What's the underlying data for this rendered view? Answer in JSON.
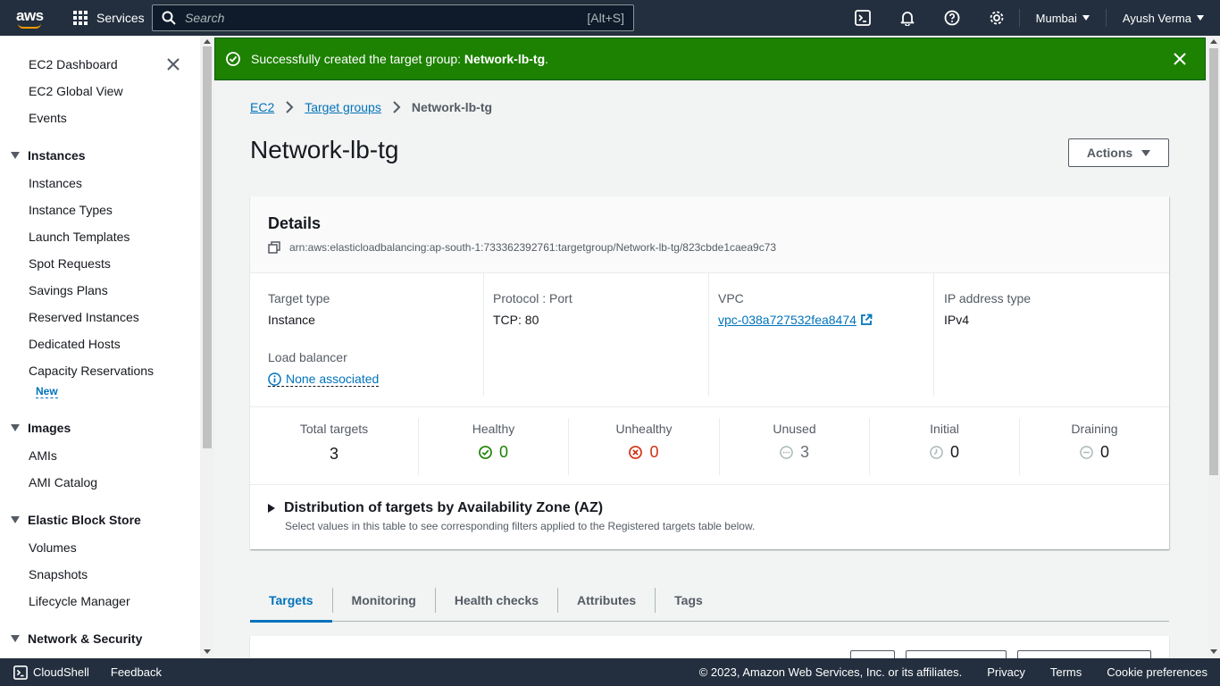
{
  "topnav": {
    "logo": "aws",
    "services_label": "Services",
    "search_placeholder": "Search",
    "search_shortcut": "[Alt+S]",
    "region": "Mumbai",
    "user": "Ayush Verma"
  },
  "sidebar": {
    "top_items": [
      "EC2 Dashboard",
      "EC2 Global View",
      "Events"
    ],
    "sections": [
      {
        "title": "Instances",
        "items": [
          "Instances",
          "Instance Types",
          "Launch Templates",
          "Spot Requests",
          "Savings Plans",
          "Reserved Instances",
          "Dedicated Hosts",
          "Capacity Reservations"
        ],
        "badge": "New"
      },
      {
        "title": "Images",
        "items": [
          "AMIs",
          "AMI Catalog"
        ]
      },
      {
        "title": "Elastic Block Store",
        "items": [
          "Volumes",
          "Snapshots",
          "Lifecycle Manager"
        ]
      },
      {
        "title": "Network & Security",
        "items": []
      }
    ]
  },
  "flash": {
    "prefix": "Successfully created the target group: ",
    "name": "Network-lb-tg",
    "suffix": "."
  },
  "breadcrumb": {
    "items": [
      "EC2",
      "Target groups"
    ],
    "current": "Network-lb-tg"
  },
  "page": {
    "title": "Network-lb-tg",
    "actions_label": "Actions"
  },
  "details": {
    "heading": "Details",
    "arn": "arn:aws:elasticloadbalancing:ap-south-1:733362392761:targetgroup/Network-lb-tg/823cbde1caea9c73",
    "target_type_label": "Target type",
    "target_type": "Instance",
    "protocol_label": "Protocol : Port",
    "protocol": "TCP: 80",
    "vpc_label": "VPC",
    "vpc": "vpc-038a727532fea8474",
    "ip_type_label": "IP address type",
    "ip_type": "IPv4",
    "lb_label": "Load balancer",
    "lb_value": "None associated"
  },
  "stats": [
    {
      "label": "Total targets",
      "value": "3",
      "icon": "none"
    },
    {
      "label": "Healthy",
      "value": "0",
      "icon": "check-circle-icon",
      "color": "#1d8102"
    },
    {
      "label": "Unhealthy",
      "value": "0",
      "icon": "x-circle-icon",
      "color": "#d13212"
    },
    {
      "label": "Unused",
      "value": "3",
      "icon": "dots-circle-icon",
      "color": "#687078"
    },
    {
      "label": "Initial",
      "value": "0",
      "icon": "clock-circle-icon",
      "color": "#687078"
    },
    {
      "label": "Draining",
      "value": "0",
      "icon": "minus-circle-icon",
      "color": "#687078"
    }
  ],
  "distribution": {
    "title": "Distribution of targets by Availability Zone (AZ)",
    "subtitle": "Select values in this table to see corresponding filters applied to the Registered targets table below."
  },
  "tabs": [
    "Targets",
    "Monitoring",
    "Health checks",
    "Attributes",
    "Tags"
  ],
  "footer": {
    "cloudshell": "CloudShell",
    "feedback": "Feedback",
    "copyright": "© 2023, Amazon Web Services, Inc. or its affiliates.",
    "privacy": "Privacy",
    "terms": "Terms",
    "cookies": "Cookie preferences"
  },
  "colors": {
    "nav_bg": "#232f3e",
    "success": "#1d8102",
    "link": "#0073bb",
    "error": "#d13212",
    "brand": "#ff9900"
  }
}
